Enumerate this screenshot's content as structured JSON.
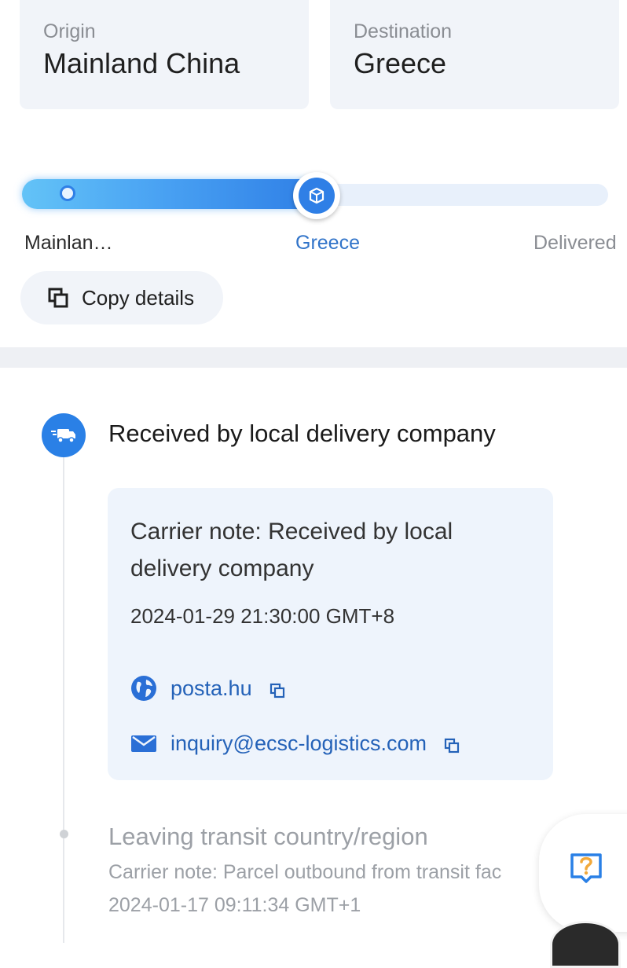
{
  "route": {
    "origin_label": "Origin",
    "origin_value": "Mainland China",
    "destination_label": "Destination",
    "destination_value": "Greece"
  },
  "progress": {
    "stages": [
      "Mainlan…",
      "Greece",
      "Delivered"
    ],
    "current_stage_index": 1,
    "fill_fraction": 0.5
  },
  "copy_button": {
    "label": "Copy details"
  },
  "events": [
    {
      "title": "Received by local delivery company",
      "note": "Carrier note: Received by local delivery company",
      "time": "2024-01-29 21:30:00 GMT+8",
      "website": "posta.hu",
      "email": "inquiry@ecsc-logistics.com"
    },
    {
      "title": "Leaving transit country/region",
      "note": "Carrier note: Parcel outbound from transit fac",
      "time": "2024-01-17 09:11:34 GMT+1"
    }
  ],
  "colors": {
    "accent": "#2a80e6",
    "link": "#2462b8",
    "muted": "#9ca0a6",
    "card_bg": "#eef4fc",
    "help": "#f2a93b"
  },
  "icons": {
    "copy": "copy-icon",
    "truck": "truck-icon",
    "globe": "globe-icon",
    "mail": "mail-icon",
    "help": "help-chat-icon",
    "package": "package-icon"
  }
}
